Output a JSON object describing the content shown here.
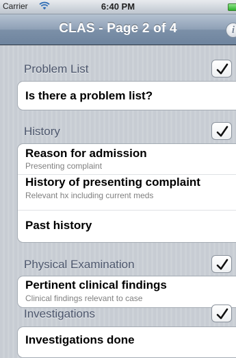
{
  "statusbar": {
    "carrier": "Carrier",
    "time": "6:40 PM"
  },
  "navbar": {
    "title": "CLAS - Page 2 of 4",
    "info_icon": "info-icon",
    "info_glyph": "i"
  },
  "sections": [
    {
      "title": "Problem List",
      "checked": true,
      "items": [
        {
          "title": "Is there a problem list?",
          "subtitle": ""
        }
      ]
    },
    {
      "title": "History",
      "checked": true,
      "items": [
        {
          "title": "Reason for admission",
          "subtitle": "Presenting complaint"
        },
        {
          "title": "History of presenting complaint",
          "subtitle": "Relevant hx including current meds"
        },
        {
          "title": "Past history",
          "subtitle": ""
        }
      ]
    },
    {
      "title": "Physical Examination",
      "checked": true,
      "items": [
        {
          "title": "Pertinent clinical findings",
          "subtitle": "Clinical findings relevant to case"
        }
      ]
    },
    {
      "title": "Investigations",
      "checked": true,
      "items": [
        {
          "title": "Investigations done",
          "subtitle": ""
        }
      ]
    }
  ],
  "colors": {
    "nav_gradient_top": "#b5c2d1",
    "nav_gradient_bottom": "#6e849e",
    "section_text": "#4c566c",
    "subtitle_text": "#7f7f7f",
    "battery": "#2bb02a"
  }
}
